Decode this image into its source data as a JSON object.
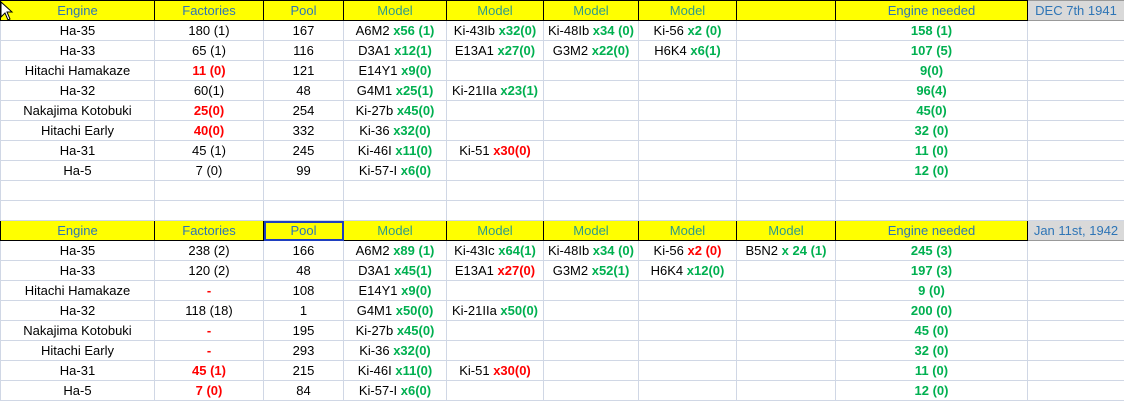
{
  "colors": {
    "header_bg": "#ffff00",
    "header_text": "#2e75b6",
    "green": "#00b050",
    "red": "#ff0000",
    "date_bg": "#d9d9d9"
  },
  "tables": [
    {
      "headers": [
        "Engine",
        "Factories",
        "Pool",
        "Model",
        "Model",
        "Model",
        "Model",
        "",
        "Engine needed"
      ],
      "date": "DEC 7th 1941",
      "rows": [
        {
          "engine": "Ha-35",
          "factories": {
            "text": "180 (1)",
            "color": "k"
          },
          "pool": "167",
          "models": [
            {
              "name": "A6M2 ",
              "count": "x56 (1)",
              "color": "g"
            },
            {
              "name": "Ki-43Ib ",
              "count": "x32(0)",
              "color": "g"
            },
            {
              "name": "Ki-48Ib ",
              "count": "x34 (0)",
              "color": "g"
            },
            {
              "name": "Ki-56 ",
              "count": "x2 (0)",
              "color": "g"
            }
          ],
          "needed": "158 (1)"
        },
        {
          "engine": "Ha-33",
          "factories": {
            "text": "65 (1)",
            "color": "k"
          },
          "pool": "116",
          "models": [
            {
              "name": "D3A1 ",
              "count": "x12(1)",
              "color": "g"
            },
            {
              "name": "E13A1 ",
              "count": "x27(0)",
              "color": "g"
            },
            {
              "name": "G3M2 ",
              "count": "x22(0)",
              "color": "g"
            },
            {
              "name": "H6K4 ",
              "count": "x6(1)",
              "color": "g"
            }
          ],
          "needed": "107 (5)"
        },
        {
          "engine": "Hitachi Hamakaze",
          "factories": {
            "text": "11 (0)",
            "color": "r"
          },
          "pool": "121",
          "models": [
            {
              "name": "E14Y1 ",
              "count": "x9(0)",
              "color": "g"
            }
          ],
          "needed": "9(0)"
        },
        {
          "engine": "Ha-32",
          "factories": {
            "text": "60(1)",
            "color": "k"
          },
          "pool": "48",
          "models": [
            {
              "name": "G4M1 ",
              "count": "x25(1)",
              "color": "g"
            },
            {
              "name": "Ki-21IIa ",
              "count": "x23(1)",
              "color": "g"
            }
          ],
          "needed": "96(4)"
        },
        {
          "engine": "Nakajima Kotobuki",
          "factories": {
            "text": "25(0)",
            "color": "r"
          },
          "pool": "254",
          "models": [
            {
              "name": "Ki-27b ",
              "count": "x45(0)",
              "color": "g"
            }
          ],
          "needed": "45(0)"
        },
        {
          "engine": "Hitachi Early",
          "factories": {
            "text": "40(0)",
            "color": "r"
          },
          "pool": "332",
          "models": [
            {
              "name": "Ki-36 ",
              "count": "x32(0)",
              "color": "g"
            }
          ],
          "needed": "32 (0)"
        },
        {
          "engine": "Ha-31",
          "factories": {
            "text": "45 (1)",
            "color": "k"
          },
          "pool": "245",
          "models": [
            {
              "name": "Ki-46I ",
              "count": "x11(0)",
              "color": "g"
            },
            {
              "name": "Ki-51 ",
              "count": "x30(0)",
              "color": "r"
            }
          ],
          "needed": "11 (0)"
        },
        {
          "engine": "Ha-5",
          "factories": {
            "text": "7 (0)",
            "color": "k"
          },
          "pool": "99",
          "models": [
            {
              "name": "Ki-57-I ",
              "count": "x6(0)",
              "color": "g"
            }
          ],
          "needed": "12 (0)"
        }
      ]
    },
    {
      "headers": [
        "Engine",
        "Factories",
        "Pool",
        "Model",
        "Model",
        "Model",
        "Model",
        "Model",
        "Engine needed"
      ],
      "date": "Jan 11st, 1942",
      "rows": [
        {
          "engine": "Ha-35",
          "factories": {
            "text": "238 (2)",
            "color": "k"
          },
          "pool": "166",
          "models": [
            {
              "name": "A6M2 ",
              "count": "x89 (1)",
              "color": "g"
            },
            {
              "name": "Ki-43Ic ",
              "count": "x64(1)",
              "color": "g"
            },
            {
              "name": "Ki-48Ib ",
              "count": "x34 (0)",
              "color": "g"
            },
            {
              "name": "Ki-56 ",
              "count": "x2 (0)",
              "color": "r"
            },
            {
              "name": "B5N2 ",
              "count": "x 24 (1)",
              "color": "g"
            }
          ],
          "needed": "245 (3)"
        },
        {
          "engine": "Ha-33",
          "factories": {
            "text": "120 (2)",
            "color": "k"
          },
          "pool": "48",
          "models": [
            {
              "name": "D3A1 ",
              "count": "x45(1)",
              "color": "g"
            },
            {
              "name": "E13A1 ",
              "count": "x27(0)",
              "color": "r"
            },
            {
              "name": "G3M2 ",
              "count": "x52(1)",
              "color": "g"
            },
            {
              "name": "H6K4 ",
              "count": "x12(0)",
              "color": "g"
            }
          ],
          "needed": "197 (3)"
        },
        {
          "engine": "Hitachi Hamakaze",
          "factories": {
            "text": "-",
            "color": "r"
          },
          "pool": "108",
          "models": [
            {
              "name": "E14Y1 ",
              "count": "x9(0)",
              "color": "g"
            }
          ],
          "needed": "9 (0)"
        },
        {
          "engine": "Ha-32",
          "factories": {
            "text": "118 (18)",
            "color": "k"
          },
          "pool": "1",
          "models": [
            {
              "name": "G4M1 ",
              "count": "x50(0)",
              "color": "g"
            },
            {
              "name": "Ki-21IIa ",
              "count": "x50(0)",
              "color": "g"
            }
          ],
          "needed": "200 (0)"
        },
        {
          "engine": "Nakajima Kotobuki",
          "factories": {
            "text": "-",
            "color": "r"
          },
          "pool": "195",
          "models": [
            {
              "name": "Ki-27b ",
              "count": "x45(0)",
              "color": "g"
            }
          ],
          "needed": "45 (0)"
        },
        {
          "engine": "Hitachi Early",
          "factories": {
            "text": "-",
            "color": "r"
          },
          "pool": "293",
          "models": [
            {
              "name": "Ki-36 ",
              "count": "x32(0)",
              "color": "g"
            }
          ],
          "needed": "32 (0)"
        },
        {
          "engine": "Ha-31",
          "factories": {
            "text": "45 (1)",
            "color": "r"
          },
          "pool": "215",
          "models": [
            {
              "name": "Ki-46I ",
              "count": "x11(0)",
              "color": "g"
            },
            {
              "name": "Ki-51 ",
              "count": "x30(0)",
              "color": "r"
            }
          ],
          "needed": "11 (0)"
        },
        {
          "engine": "Ha-5",
          "factories": {
            "text": "7 (0)",
            "color": "r"
          },
          "pool": "84",
          "models": [
            {
              "name": "Ki-57-I ",
              "count": "x6(0)",
              "color": "g"
            }
          ],
          "needed": "12 (0)"
        }
      ]
    }
  ]
}
